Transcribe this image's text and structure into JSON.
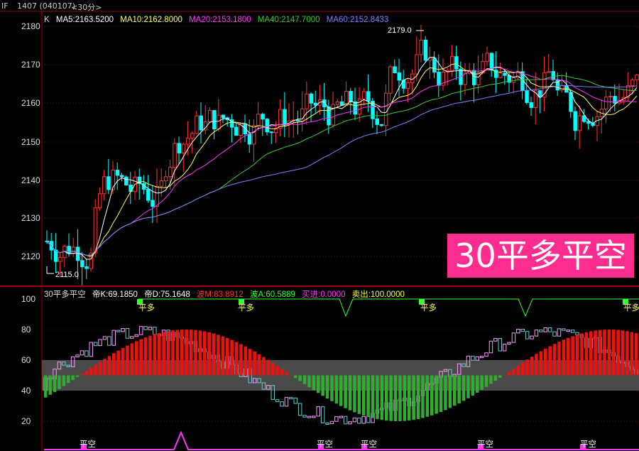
{
  "header": {
    "symbol": "IF",
    "contract": "1407 (040107)",
    "period": "<30分>"
  },
  "main_panel": {
    "indicator_label": "K",
    "ma": [
      {
        "label": "MA5:2163.5200",
        "color": "#ffffff"
      },
      {
        "label": "MA10:2162.8000",
        "color": "#ffff66"
      },
      {
        "label": "MA20:2153.1800",
        "color": "#ff33ff"
      },
      {
        "label": "MA40:2147.7000",
        "color": "#33cc33"
      },
      {
        "label": "MA60:2152.8433",
        "color": "#8080ff"
      }
    ],
    "y_ticks": [
      "2180",
      "2170",
      "2160",
      "2150",
      "2140",
      "2130",
      "2120"
    ],
    "high_marker": "2179.0",
    "low_marker": "2115.0",
    "badge": "30平多平空"
  },
  "sub_panel": {
    "title": "30平多平空",
    "values": [
      {
        "label": "帝K:69.1850",
        "color": "#ffffff"
      },
      {
        "label": "帝D:75.1648",
        "color": "#ffffff"
      },
      {
        "label": "波M:83.8912",
        "color": "#ff3333"
      },
      {
        "label": "波A:60.5889",
        "color": "#33ff33"
      },
      {
        "label": "买进:0.0000",
        "color": "#ff33ff"
      },
      {
        "label": "卖出:100.0000",
        "color": "#ffff33"
      }
    ],
    "y_ticks": [
      "100",
      "80",
      "60",
      "40",
      "20"
    ],
    "buy_signals": [
      "平多",
      "平多",
      "平多",
      "平多"
    ],
    "sell_signals": [
      "平空",
      "平空",
      "平空",
      "平空",
      "平空"
    ]
  },
  "colors": {
    "up": "#ff3333",
    "down": "#00ffff",
    "grid": "#800000",
    "border": "#a00000"
  }
}
